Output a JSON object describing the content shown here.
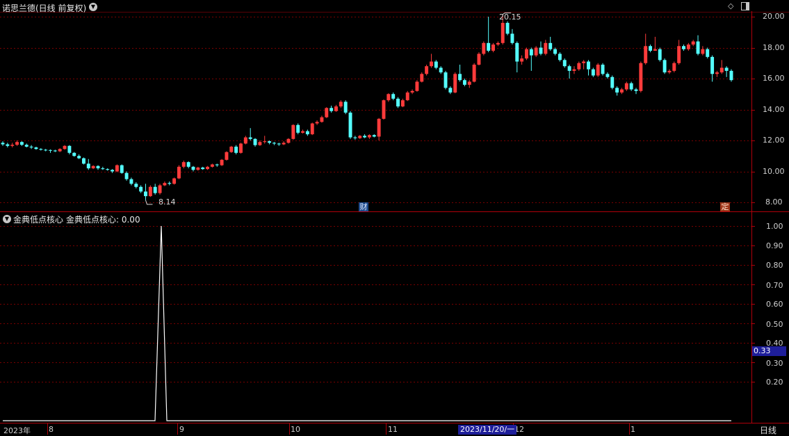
{
  "colors": {
    "up": "#ff3b3b",
    "down": "#54ffff",
    "border": "#b0000a",
    "grid": "#7a0000",
    "indicator_line": "#ffffff",
    "axis_text": "#d0d0d0",
    "date_badge_bg": "#1e1e9a",
    "value_badge_bg": "#1e1e9a",
    "cai_badge_bg": "#1e4a8c",
    "ding_badge_bg": "#a0371a"
  },
  "header": {
    "title": "诺思兰德(日线 前复权)",
    "title_dropdown_icon": "chevron-down-icon",
    "diamond_icon": "diamond-icon",
    "layout_icon": "panel-layout-icon"
  },
  "price_panel": {
    "y_axis_labels": [
      "20.00",
      "18.00",
      "16.00",
      "14.00",
      "12.00",
      "10.00",
      "8.00"
    ],
    "high_marker": "20.15",
    "low_marker": "8.14",
    "cai_badge": "财",
    "ding_badge": "定"
  },
  "indicator_panel": {
    "name": "金典低点核心",
    "value_label": "金典低点核心: 0.00",
    "y_axis_labels": [
      "1.00",
      "0.90",
      "0.80",
      "0.70",
      "0.60",
      "0.50",
      "0.40",
      "0.30",
      "0.20"
    ],
    "current_value_badge": "0.33",
    "series": {
      "name": "金典低点核心",
      "peak_value": 1.0,
      "baseline_value": 0.0
    }
  },
  "x_axis": {
    "labels": [
      "2023年",
      "8",
      "9",
      "10",
      "11",
      "12",
      "1"
    ],
    "cursor_date": "2023/11/20/一",
    "timeframe": "日线"
  },
  "chart_data": {
    "type": "candlestick",
    "title": "诺思兰德(日线 前复权)",
    "ylim": [
      7.5,
      20.5
    ],
    "high": 20.15,
    "low": 8.14,
    "candles": [
      [
        11.85,
        11.75,
        11.95,
        11.65
      ],
      [
        11.75,
        11.65,
        11.85,
        11.55
      ],
      [
        11.65,
        11.72,
        11.85,
        11.55
      ],
      [
        11.72,
        11.9,
        12.0,
        11.65
      ],
      [
        11.9,
        11.72,
        11.95,
        11.65
      ],
      [
        11.72,
        11.6,
        11.8,
        11.55
      ],
      [
        11.6,
        11.55,
        11.7,
        11.45
      ],
      [
        11.55,
        11.45,
        11.6,
        11.4
      ],
      [
        11.45,
        11.4,
        11.5,
        11.35
      ],
      [
        11.4,
        11.38,
        11.45,
        11.3
      ],
      [
        11.38,
        11.35,
        11.42,
        11.2
      ],
      [
        11.35,
        11.3,
        11.4,
        11.25
      ],
      [
        11.3,
        11.45,
        11.5,
        11.25
      ],
      [
        11.45,
        11.65,
        11.7,
        11.4
      ],
      [
        11.65,
        11.2,
        11.7,
        11.1
      ],
      [
        11.2,
        11.0,
        11.25,
        10.95
      ],
      [
        11.0,
        10.85,
        11.1,
        10.8
      ],
      [
        10.85,
        10.5,
        10.9,
        10.45
      ],
      [
        10.5,
        10.2,
        10.8,
        10.1
      ],
      [
        10.2,
        10.35,
        10.4,
        10.15
      ],
      [
        10.35,
        10.2,
        10.4,
        10.1
      ],
      [
        10.2,
        10.15,
        10.3,
        10.1
      ],
      [
        10.15,
        10.1,
        10.2,
        10.05
      ],
      [
        10.1,
        10.0,
        10.15,
        9.9
      ],
      [
        10.0,
        10.4,
        10.45,
        9.95
      ],
      [
        10.4,
        9.9,
        10.45,
        9.85
      ],
      [
        9.9,
        9.5,
        10.0,
        9.4
      ],
      [
        9.5,
        9.2,
        9.6,
        9.1
      ],
      [
        9.2,
        9.0,
        9.3,
        8.9
      ],
      [
        9.0,
        8.7,
        9.1,
        8.6
      ],
      [
        8.7,
        8.4,
        9.2,
        8.14
      ],
      [
        8.4,
        9.0,
        9.1,
        8.35
      ],
      [
        9.0,
        8.6,
        9.2,
        8.5
      ],
      [
        8.6,
        9.1,
        9.2,
        8.5
      ],
      [
        9.1,
        9.25,
        9.35,
        9.05
      ],
      [
        9.25,
        9.2,
        9.35,
        9.1
      ],
      [
        9.2,
        9.55,
        9.6,
        9.15
      ],
      [
        9.55,
        10.3,
        10.4,
        9.5
      ],
      [
        10.3,
        10.6,
        10.7,
        10.2
      ],
      [
        10.6,
        10.3,
        10.65,
        10.2
      ],
      [
        10.3,
        10.1,
        10.35,
        10.0
      ],
      [
        10.1,
        10.25,
        10.3,
        10.05
      ],
      [
        10.25,
        10.15,
        10.3,
        10.1
      ],
      [
        10.15,
        10.3,
        10.35,
        10.1
      ],
      [
        10.3,
        10.45,
        10.5,
        10.25
      ],
      [
        10.45,
        10.4,
        10.5,
        10.3
      ],
      [
        10.4,
        10.75,
        10.8,
        10.35
      ],
      [
        10.75,
        11.25,
        11.3,
        10.7
      ],
      [
        11.25,
        11.6,
        11.65,
        11.2
      ],
      [
        11.6,
        11.2,
        11.7,
        11.1
      ],
      [
        11.2,
        11.8,
        11.85,
        11.15
      ],
      [
        11.8,
        12.2,
        12.3,
        11.75
      ],
      [
        12.2,
        12.1,
        12.8,
        12.0
      ],
      [
        12.1,
        11.7,
        12.15,
        11.6
      ],
      [
        11.7,
        11.9,
        12.0,
        11.65
      ],
      [
        11.9,
        11.95,
        12.3,
        11.8
      ],
      [
        11.95,
        11.85,
        12.0,
        11.75
      ],
      [
        11.85,
        11.8,
        11.9,
        11.7
      ],
      [
        11.8,
        11.75,
        11.85,
        11.65
      ],
      [
        11.75,
        11.85,
        11.95,
        11.7
      ],
      [
        11.85,
        12.1,
        12.15,
        11.8
      ],
      [
        12.1,
        13.0,
        13.05,
        12.05
      ],
      [
        13.0,
        12.5,
        13.1,
        12.4
      ],
      [
        12.5,
        12.6,
        12.7,
        12.45
      ],
      [
        12.6,
        12.4,
        12.7,
        12.3
      ],
      [
        12.4,
        13.1,
        13.15,
        12.35
      ],
      [
        13.1,
        13.2,
        13.3,
        13.0
      ],
      [
        13.2,
        13.5,
        13.6,
        13.15
      ],
      [
        13.5,
        14.1,
        14.15,
        13.45
      ],
      [
        14.1,
        13.9,
        14.25,
        13.8
      ],
      [
        13.9,
        14.2,
        14.3,
        13.85
      ],
      [
        14.2,
        14.5,
        14.6,
        14.1
      ],
      [
        14.5,
        13.8,
        14.6,
        13.7
      ],
      [
        13.8,
        12.2,
        13.9,
        12.1
      ],
      [
        12.2,
        12.15,
        12.3,
        12.05
      ],
      [
        12.15,
        12.3,
        12.35,
        12.1
      ],
      [
        12.3,
        12.2,
        12.4,
        12.15
      ],
      [
        12.2,
        12.35,
        12.4,
        12.1
      ],
      [
        12.35,
        12.25,
        12.4,
        12.2
      ],
      [
        12.25,
        13.4,
        13.45,
        12.0
      ],
      [
        13.4,
        14.6,
        14.65,
        13.35
      ],
      [
        14.6,
        15.0,
        15.05,
        14.5
      ],
      [
        15.0,
        14.7,
        15.1,
        14.6
      ],
      [
        14.7,
        14.2,
        14.8,
        14.1
      ],
      [
        14.2,
        14.6,
        14.7,
        14.15
      ],
      [
        14.6,
        15.1,
        15.2,
        14.55
      ],
      [
        15.1,
        15.2,
        15.3,
        15.0
      ],
      [
        15.2,
        15.8,
        15.9,
        15.15
      ],
      [
        15.8,
        16.3,
        16.4,
        15.75
      ],
      [
        16.3,
        16.8,
        16.9,
        16.2
      ],
      [
        16.8,
        17.1,
        17.6,
        16.7
      ],
      [
        17.1,
        16.7,
        17.2,
        16.6
      ],
      [
        16.7,
        16.4,
        16.8,
        16.3
      ],
      [
        16.4,
        15.4,
        16.5,
        15.3
      ],
      [
        15.4,
        15.1,
        15.5,
        15.0
      ],
      [
        15.1,
        16.3,
        16.4,
        15.05
      ],
      [
        16.3,
        15.9,
        16.9,
        15.8
      ],
      [
        15.9,
        15.6,
        16.0,
        15.5
      ],
      [
        15.6,
        15.8,
        15.9,
        15.4
      ],
      [
        15.8,
        16.9,
        17.0,
        15.75
      ],
      [
        16.9,
        17.6,
        17.7,
        16.85
      ],
      [
        17.6,
        18.3,
        18.4,
        17.5
      ],
      [
        18.3,
        17.8,
        20.0,
        17.7
      ],
      [
        17.8,
        18.2,
        18.3,
        17.7
      ],
      [
        18.2,
        18.3,
        18.4,
        18.1
      ],
      [
        18.3,
        19.6,
        20.15,
        18.2
      ],
      [
        19.6,
        18.9,
        19.7,
        18.8
      ],
      [
        18.9,
        18.3,
        19.2,
        18.2
      ],
      [
        18.3,
        17.1,
        18.4,
        16.4
      ],
      [
        17.1,
        17.3,
        17.5,
        16.9
      ],
      [
        17.3,
        17.9,
        18.0,
        17.2
      ],
      [
        17.9,
        17.5,
        18.0,
        16.5
      ],
      [
        17.5,
        18.0,
        18.1,
        17.4
      ],
      [
        18.0,
        17.6,
        18.4,
        17.5
      ],
      [
        17.6,
        18.3,
        18.5,
        17.5
      ],
      [
        18.3,
        17.9,
        18.7,
        17.8
      ],
      [
        17.9,
        17.6,
        18.0,
        17.5
      ],
      [
        17.6,
        17.2,
        17.7,
        17.1
      ],
      [
        17.2,
        16.8,
        17.3,
        16.7
      ],
      [
        16.8,
        16.5,
        16.9,
        16.0
      ],
      [
        16.5,
        16.6,
        16.8,
        16.3
      ],
      [
        16.6,
        17.0,
        17.1,
        16.5
      ],
      [
        17.0,
        17.1,
        17.2,
        16.6
      ],
      [
        17.1,
        16.6,
        17.2,
        16.2
      ],
      [
        16.6,
        16.2,
        16.7,
        16.1
      ],
      [
        16.2,
        16.9,
        17.0,
        16.1
      ],
      [
        16.9,
        16.3,
        17.0,
        16.2
      ],
      [
        16.3,
        16.1,
        16.4,
        16.0
      ],
      [
        16.1,
        15.4,
        16.2,
        15.3
      ],
      [
        15.4,
        15.1,
        15.5,
        14.9
      ],
      [
        15.1,
        15.3,
        15.4,
        15.0
      ],
      [
        15.3,
        15.7,
        15.8,
        15.2
      ],
      [
        15.7,
        15.3,
        15.8,
        15.2
      ],
      [
        15.3,
        15.2,
        15.4,
        15.0
      ],
      [
        15.2,
        17.0,
        17.1,
        15.1
      ],
      [
        17.0,
        18.1,
        18.9,
        16.9
      ],
      [
        18.1,
        17.8,
        18.2,
        17.7
      ],
      [
        17.8,
        17.9,
        18.7,
        17.8
      ],
      [
        17.9,
        17.2,
        18.0,
        17.1
      ],
      [
        17.2,
        16.4,
        17.3,
        16.3
      ],
      [
        16.4,
        16.5,
        16.6,
        16.3
      ],
      [
        16.5,
        17.0,
        17.1,
        16.4
      ],
      [
        17.0,
        18.1,
        18.5,
        16.9
      ],
      [
        18.1,
        17.9,
        18.2,
        17.8
      ],
      [
        17.9,
        18.2,
        18.3,
        17.8
      ],
      [
        18.2,
        18.4,
        18.5,
        18.1
      ],
      [
        18.4,
        17.6,
        18.8,
        17.5
      ],
      [
        17.6,
        17.9,
        18.1,
        17.5
      ],
      [
        17.9,
        17.4,
        18.0,
        17.3
      ],
      [
        17.4,
        16.3,
        17.5,
        15.8
      ],
      [
        16.3,
        16.4,
        16.5,
        16.1
      ],
      [
        16.4,
        16.7,
        17.2,
        16.3
      ],
      [
        16.7,
        16.5,
        16.8,
        16.1
      ],
      [
        16.5,
        15.9,
        16.6,
        15.8
      ]
    ]
  }
}
